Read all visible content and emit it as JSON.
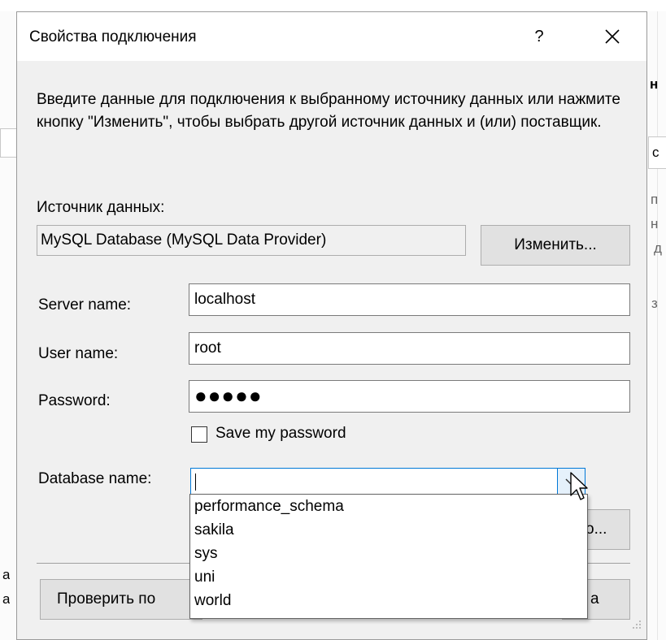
{
  "background": {
    "fragments": [
      "н",
      "с",
      "п",
      "н",
      "д",
      "з",
      "а",
      "а"
    ]
  },
  "dialog": {
    "title": "Свойства подключения",
    "help_label": "?",
    "intro_text": "Введите данные для подключения к выбранному источнику данных или нажмите кнопку \"Изменить\", чтобы выбрать другой источник данных и (или) поставщик.",
    "data_source_label": "Источник данных:",
    "data_source_value": "MySQL Database (MySQL Data Provider)",
    "change_button": "Изменить...",
    "server_name_label": "Server name:",
    "server_name_value": "localhost",
    "user_name_label": "User name:",
    "user_name_value": "root",
    "password_label": "Password:",
    "password_mask": "●●●●●",
    "save_password_label": "Save my password",
    "save_password_checked": false,
    "database_name_label": "Database name:",
    "database_name_value": "",
    "partial_button_text": "о...",
    "test_connection_button": "Проверить по",
    "ok_partial": "а",
    "database_options": [
      "performance_schema",
      "sakila",
      "sys",
      "uni",
      "world"
    ],
    "accent_color": "#0078d7"
  }
}
